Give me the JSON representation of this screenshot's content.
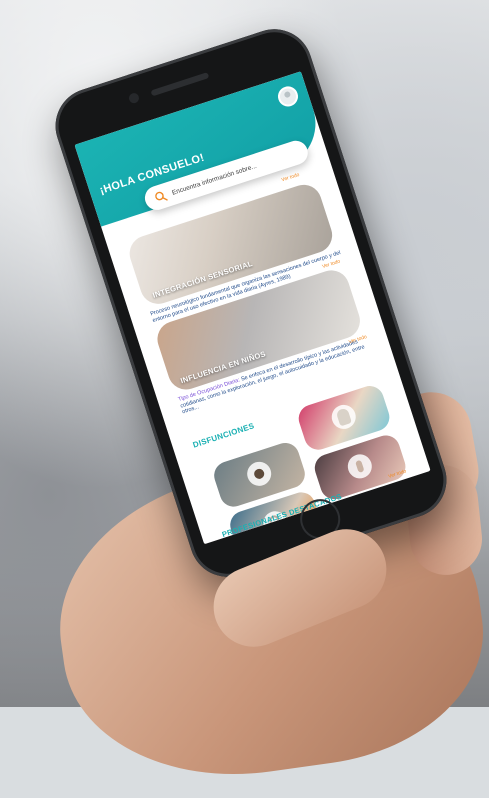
{
  "app": {
    "greeting": "¡HOLA CONSUELO!",
    "search_placeholder": "Encuentra información sobre...",
    "sections": {
      "ver_todo": "Ver todo",
      "dysfunctions_title": "DISFUNCIONES",
      "professionals_title": "PROFESIONALES DESTACADOS"
    },
    "cards": [
      {
        "title": "INTEGRACIÓN SENSORIAL",
        "description": "Proceso neurológico fundamental que organiza las sensaciones del cuerpo y del entorno para el uso efectivo en la vida diaria (Ayres, 1989)"
      },
      {
        "title": "INFLUENCIA EN NIÑOS",
        "description_highlight": "Tipo de Ocupación Diaria:",
        "description": " Se enfoca en el desarrollo típico y las actividades cotidianas, como la exploración, el juego, el autocuidado y la educación, entre otros..."
      }
    ],
    "dysfunction_icons": [
      "eye-icon",
      "hand-icon",
      "ear-icon",
      "nose-icon"
    ]
  },
  "colors": {
    "teal": "#1bb0b3",
    "orange": "#f08a24",
    "text_blue": "#1f4a8a",
    "highlight_purple": "#7a4fd8"
  }
}
